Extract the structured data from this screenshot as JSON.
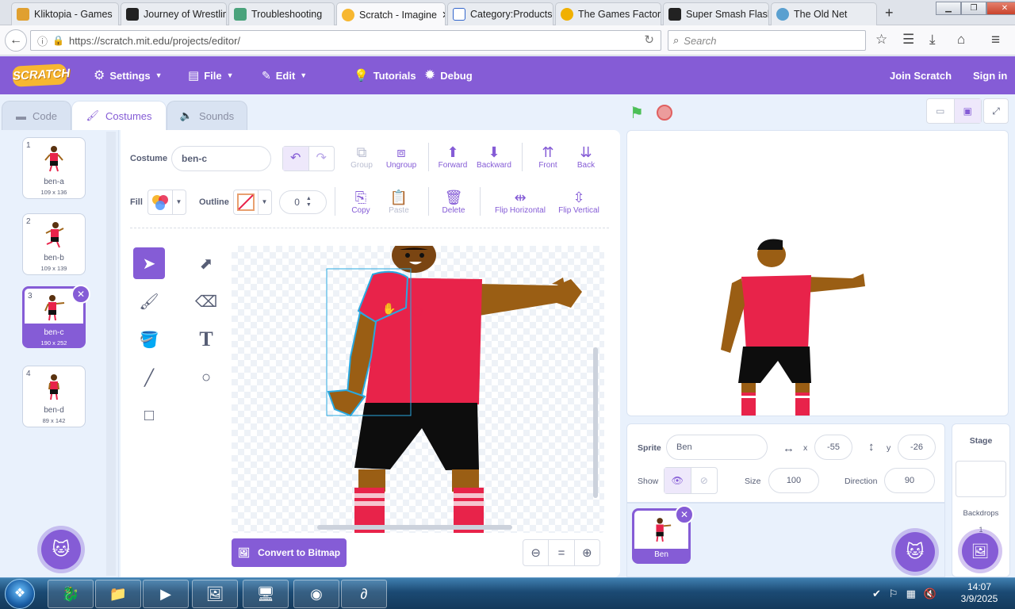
{
  "browser": {
    "tabs": [
      {
        "title": "Kliktopia - Games",
        "color": "#e0a030"
      },
      {
        "title": "Journey of Wrestling",
        "color": "#222222"
      },
      {
        "title": "Troubleshooting",
        "color": "#4aa37c"
      },
      {
        "title": "Scratch - Imagine",
        "color": "#f7b731"
      },
      {
        "title": "Category:Products - C",
        "color": "#3366cc"
      },
      {
        "title": "The Games Factory",
        "color": "#f0b000"
      },
      {
        "title": "Super Smash Flash",
        "color": "#222222"
      },
      {
        "title": "The Old Net",
        "color": "#5aa0d0"
      }
    ],
    "url": "https://scratch.mit.edu/projects/editor/",
    "search_placeholder": "Search"
  },
  "menu": {
    "logo": "SCRATCH",
    "settings": "Settings",
    "file": "File",
    "edit": "Edit",
    "tutorials": "Tutorials",
    "debug": "Debug",
    "join": "Join Scratch",
    "signin": "Sign in"
  },
  "editor_tabs": {
    "code": "Code",
    "costumes": "Costumes",
    "sounds": "Sounds"
  },
  "costumes": [
    {
      "num": "1",
      "name": "ben-a",
      "size": "109 x 136"
    },
    {
      "num": "2",
      "name": "ben-b",
      "size": "109 x 139"
    },
    {
      "num": "3",
      "name": "ben-c",
      "size": "190 x 252"
    },
    {
      "num": "4",
      "name": "ben-d",
      "size": "89 x 142"
    }
  ],
  "paint": {
    "costume_label": "Costume",
    "costume_name": "ben-c",
    "fill_label": "Fill",
    "outline_label": "Outline",
    "outline_width": "0",
    "tools_row1": [
      "Group",
      "Ungroup",
      "Forward",
      "Backward",
      "Front",
      "Back"
    ],
    "tools_row2": [
      "Copy",
      "Paste",
      "Delete",
      "Flip Horizontal",
      "Flip Vertical"
    ],
    "convert_button": "Convert to Bitmap",
    "zoom_reset": "="
  },
  "sprite": {
    "label": "Sprite",
    "name": "Ben",
    "x_label": "x",
    "x": "-55",
    "y_label": "y",
    "y": "-26",
    "show_label": "Show",
    "size_label": "Size",
    "size": "100",
    "direction_label": "Direction",
    "direction": "90",
    "list_name": "Ben"
  },
  "stage_panel": {
    "title": "Stage",
    "backdrops_label": "Backdrops",
    "backdrops_count": "1"
  },
  "taskbar": {
    "time": "14:07",
    "date": "3/9/2025"
  },
  "colors": {
    "accent": "#855cd6",
    "shirt": "#e8234a",
    "skin": "#a0651a",
    "selection": "#29a8e0"
  }
}
